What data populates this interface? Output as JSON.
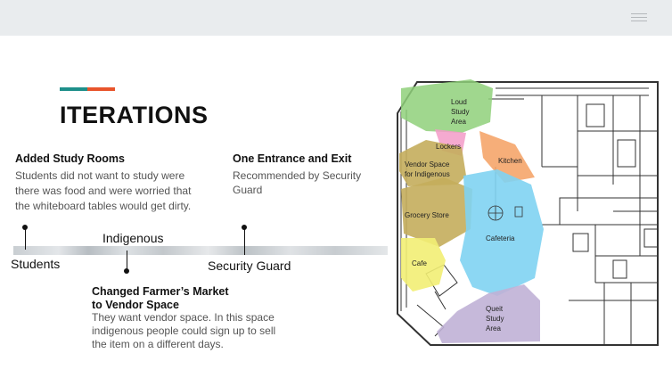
{
  "colors": {
    "accent_teal": "#1e8f8a",
    "accent_orange": "#e8542b"
  },
  "header": {
    "menu_icon": "hamburger-menu-icon"
  },
  "title": "ITERATIONS",
  "items": {
    "study_rooms": {
      "heading": "Added Study Rooms",
      "body": [
        "Students did not want to study were",
        "there was food and were worried that",
        "the whiteboard tables would get dirty."
      ]
    },
    "entrance": {
      "heading": "One Entrance and Exit",
      "body": [
        "Recommended by Security",
        "Guard"
      ]
    },
    "vendor": {
      "heading": [
        "Changed Farmer’s Market",
        "to Vendor Space"
      ],
      "body": [
        "They want  vendor space.  In this space",
        "indigenous people could sign up to sell",
        "the item on a different days."
      ]
    }
  },
  "timeline": {
    "students": "Students",
    "indigenous": "Indigenous",
    "security": "Security Guard"
  },
  "map": {
    "loud": [
      "Loud",
      "Study",
      "Area"
    ],
    "lockers": "Lockers",
    "kitchen": "Kitchen",
    "vendor": [
      "Vendor Space",
      "for Indigenous"
    ],
    "grocery": "Grocery Store",
    "cafeteria": "Cafeteria",
    "cafe": "Cafe",
    "quiet": [
      "Queit",
      "Study",
      "Area"
    ]
  }
}
